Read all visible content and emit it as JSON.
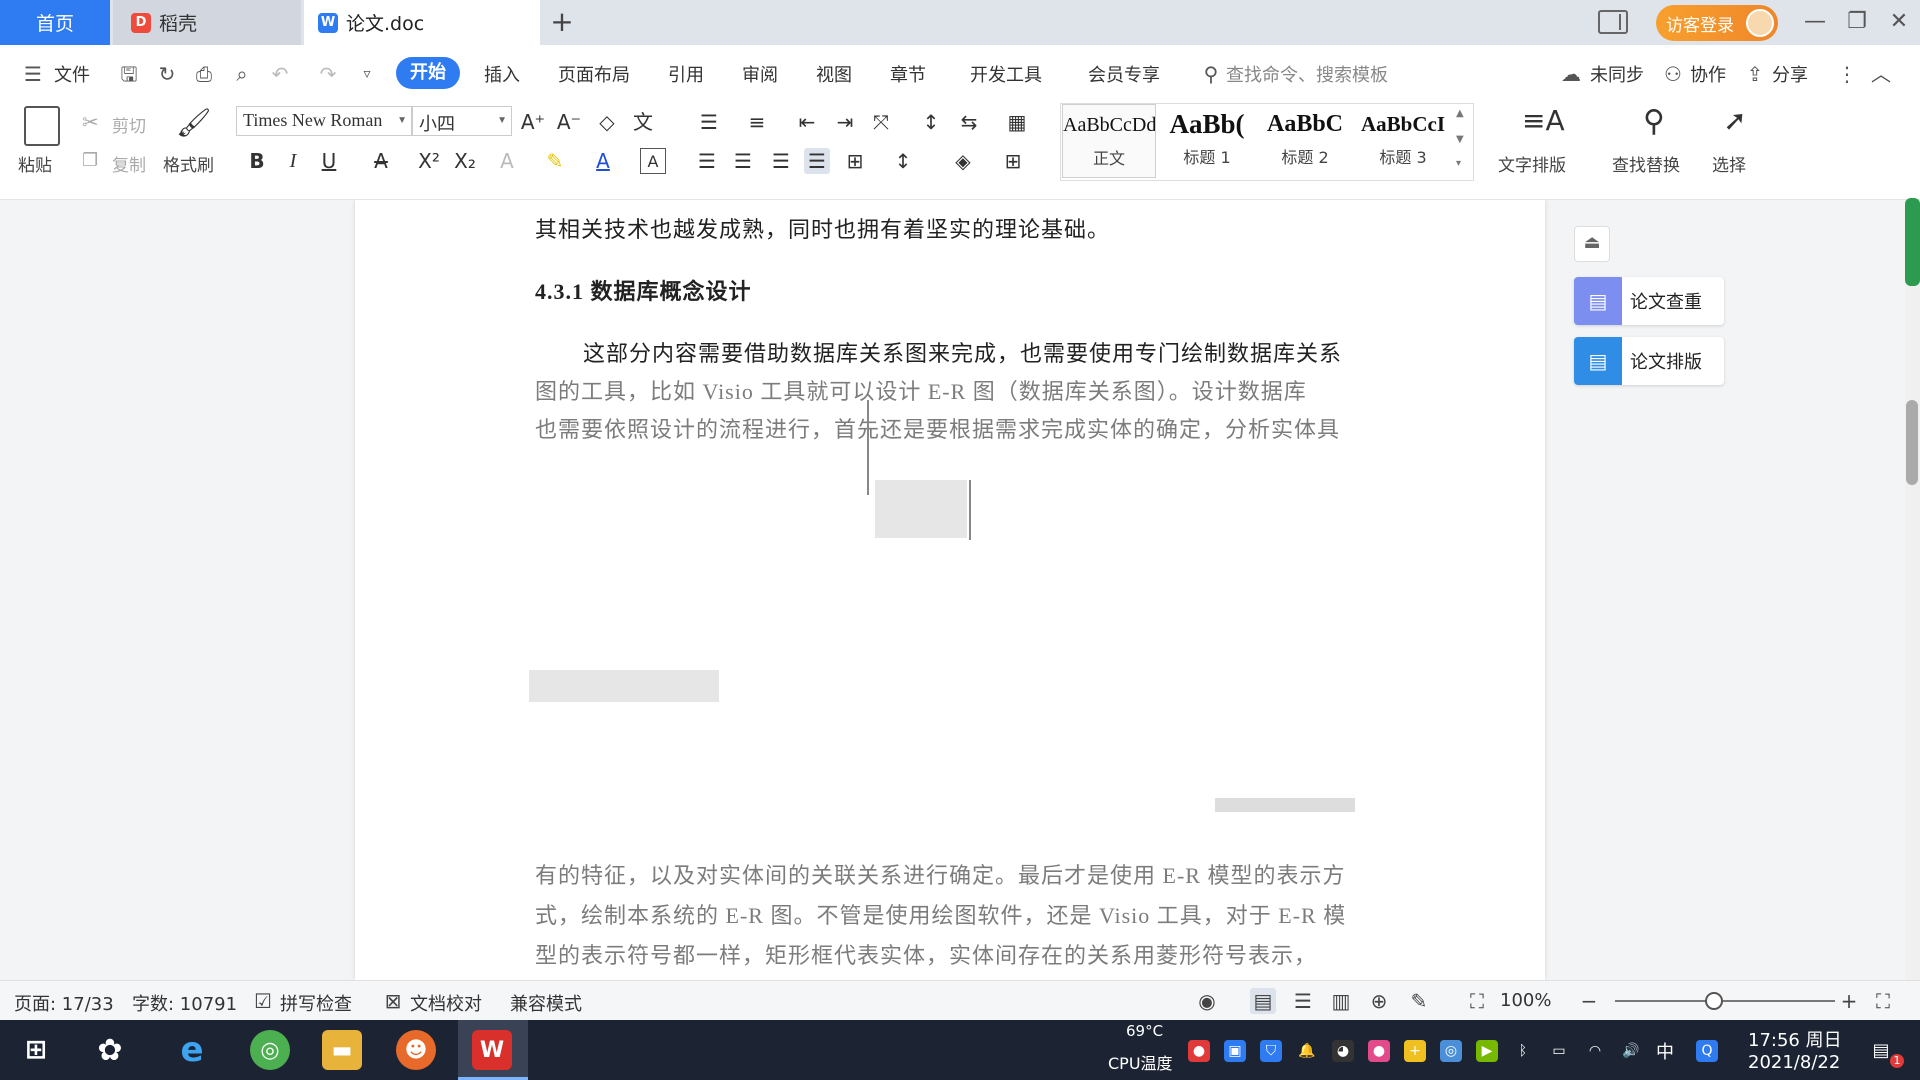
{
  "tabs": {
    "home": "首页",
    "daoke": "稻壳",
    "doc": "论文.doc",
    "add": "+"
  },
  "topbar": {
    "visitor_login": "访客登录",
    "minimize": "—",
    "restore": "❐",
    "close": "✕"
  },
  "menu": {
    "file": "文件",
    "items": [
      "开始",
      "插入",
      "页面布局",
      "引用",
      "审阅",
      "视图",
      "章节",
      "开发工具",
      "会员专享"
    ],
    "search_placeholder": "查找命令、搜索模板",
    "unsynced": "未同步",
    "collab": "协作",
    "share": "分享"
  },
  "ribbon": {
    "paste": "粘贴",
    "cut": "剪切",
    "copy": "复制",
    "format_painter": "格式刷",
    "font_name": "Times New Roman",
    "font_size": "小四",
    "styles": [
      {
        "sample": "AaBbCcDd",
        "label": "正文"
      },
      {
        "sample": "AaBb(",
        "label": "标题 1"
      },
      {
        "sample": "AaBbC",
        "label": "标题 2"
      },
      {
        "sample": "AaBbCcI",
        "label": "标题 3"
      }
    ],
    "text_layout": "文字排版",
    "find_replace": "查找替换",
    "select": "选择"
  },
  "document": {
    "line1": "其相关技术也越发成熟，同时也拥有着坚实的理论基础。",
    "heading": "4.3.1  数据库概念设计",
    "para1": "这部分内容需要借助数据库关系图来完成，也需要使用专门绘制数据库关系",
    "para2": "图的工具，比如 Visio 工具就可以设计 E-R 图（数据库关系图）。设计数据库",
    "para3": "也需要依照设计的流程进行，首先还是要根据需求完成实体的确定，分析实体具",
    "para4": "有的特征，以及对实体间的关联关系进行确定。最后才是使用 E-R 模型的表示方",
    "para5": "式，绘制本系统的 E-R 图。不管是使用绘图软件，还是 Visio 工具，对于 E-R 模",
    "para6": "型的表示符号都一样，矩形框代表实体，实体间存在的关系用菱形符号表示，"
  },
  "side_panel": {
    "check": "论文查重",
    "layout": "论文排版"
  },
  "status": {
    "page": "页面: 17/33",
    "words": "字数: 10791",
    "spell": "拼写检查",
    "proof": "文档校对",
    "compat": "兼容模式",
    "zoom": "100%"
  },
  "taskbar": {
    "cpu_temp": "69°C",
    "cpu_label": "CPU温度",
    "ime": "中",
    "time": "17:56 周日",
    "date": "2021/8/22",
    "notif_count": "1"
  },
  "colors": {
    "accent": "#2f7bf2",
    "login": "#f0862a",
    "taskbar": "#1c2433"
  }
}
